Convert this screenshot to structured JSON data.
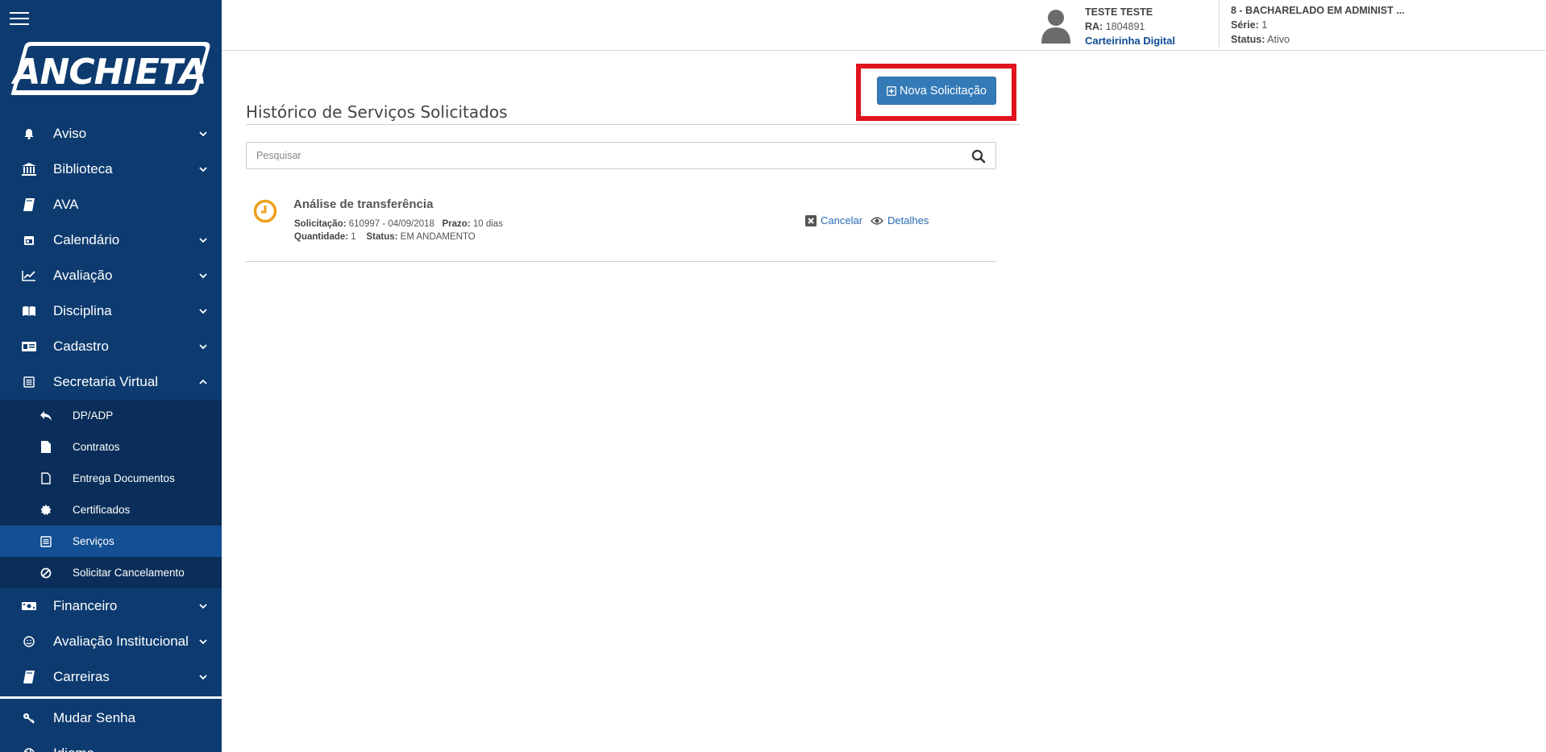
{
  "sidebar": {
    "logo_text": "ANCHIETA",
    "menu": [
      {
        "label": "Aviso",
        "icon": "bell-icon",
        "has_chevron": true
      },
      {
        "label": "Biblioteca",
        "icon": "institution-icon",
        "has_chevron": true
      },
      {
        "label": "AVA",
        "icon": "book-icon",
        "has_chevron": false
      },
      {
        "label": "Calendário",
        "icon": "calendar-icon",
        "has_chevron": true
      },
      {
        "label": "Avaliação",
        "icon": "line-chart-icon",
        "has_chevron": true
      },
      {
        "label": "Disciplina",
        "icon": "open-book-icon",
        "has_chevron": true
      },
      {
        "label": "Cadastro",
        "icon": "id-card-icon",
        "has_chevron": true
      },
      {
        "label": "Secretaria Virtual",
        "icon": "document-icon",
        "has_chevron": true,
        "expanded": true
      }
    ],
    "submenu": [
      {
        "label": "DP/ADP",
        "icon": "reply-all-icon"
      },
      {
        "label": "Contratos",
        "icon": "file-icon"
      },
      {
        "label": "Entrega Documentos",
        "icon": "file-outline-icon"
      },
      {
        "label": "Certificados",
        "icon": "certificate-icon"
      },
      {
        "label": "Serviços",
        "icon": "list-alt-icon",
        "active": true
      },
      {
        "label": "Solicitar Cancelamento",
        "icon": "ban-icon"
      }
    ],
    "menu_bottom": [
      {
        "label": "Financeiro",
        "icon": "money-icon",
        "has_chevron": true
      },
      {
        "label": "Avaliação Institucional",
        "icon": "smile-icon",
        "has_chevron": true
      },
      {
        "label": "Carreiras",
        "icon": "book-icon",
        "has_chevron": true
      }
    ],
    "menu_footer": [
      {
        "label": "Mudar Senha",
        "icon": "key-icon"
      },
      {
        "label": "Idioma",
        "icon": "globe-icon"
      }
    ]
  },
  "header": {
    "user_name": "TESTE TESTE",
    "ra_label": "RA:",
    "ra_value": "1804891",
    "card_link": "Carteirinha Digital",
    "course_title": "8 - BACHARELADO EM ADMINIST ...",
    "serie_label": "Série:",
    "serie_value": "1",
    "status_label": "Status:",
    "status_value": "Ativo"
  },
  "main": {
    "title": "Histórico de Serviços Solicitados",
    "new_button_label": "Nova Solicitação",
    "search_placeholder": "Pesquisar",
    "requests": [
      {
        "title": "Análise de transferência",
        "solicitacao_label": "Solicitação:",
        "solicitacao_value": "610997 - 04/09/2018",
        "prazo_label": "Prazo:",
        "prazo_value": "10 dias",
        "quantidade_label": "Quantidade:",
        "quantidade_value": "1",
        "status_label": "Status:",
        "status_value": "EM ANDAMENTO",
        "cancel_label": "Cancelar",
        "details_label": "Detalhes"
      }
    ]
  },
  "colors": {
    "sidebar_bg": "#0d3b70",
    "submenu_bg": "#0a2e59",
    "active_item": "#134f93",
    "primary_button": "#337ab7",
    "highlight": "#e0141e",
    "status_pending": "#f0a01e",
    "link": "#2a6ab3"
  }
}
